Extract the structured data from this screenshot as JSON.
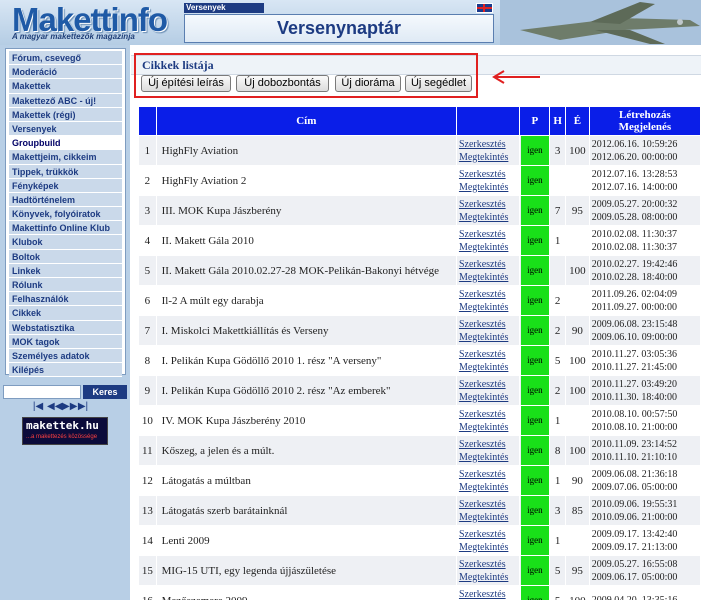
{
  "header": {
    "logo_title": "Makettinfo",
    "logo_subtitle": "A magyar makettezők magazinja",
    "section_tag": "Versenyek",
    "page_heading": "Versenynaptár"
  },
  "sidebar": {
    "items": [
      {
        "label": "Fórum, csevegő"
      },
      {
        "label": "Moderáció"
      },
      {
        "label": "Makettek"
      },
      {
        "label": "Makettező ABC - új!"
      },
      {
        "label": "Makettek (régi)"
      },
      {
        "label": "Versenyek"
      },
      {
        "label": "Groupbuild",
        "active": true
      },
      {
        "label": "Makettjeim, cikkeim"
      },
      {
        "label": "Tippek, trükkök"
      },
      {
        "label": "Fényképek"
      },
      {
        "label": "Hadtörténelem"
      },
      {
        "label": "Könyvek, folyóiratok"
      },
      {
        "label": "Makettinfo Online Klub"
      },
      {
        "label": "Klubok"
      },
      {
        "label": "Boltok"
      },
      {
        "label": "Linkek"
      },
      {
        "label": "Rólunk"
      },
      {
        "label": "Felhasználók"
      },
      {
        "label": "Cikkek"
      },
      {
        "label": "Webstatisztika"
      },
      {
        "label": "MOK tagok"
      },
      {
        "label": "Személyes adatok"
      },
      {
        "label": "Kilépés"
      }
    ],
    "search": {
      "placeholder": "",
      "button_label": "Keres"
    },
    "pager": {
      "first": "|◀",
      "prev": "◀◀",
      "next": "▶▶",
      "last": "▶|"
    },
    "banner": {
      "title": "makettek.hu",
      "subtitle": "...a makettezés közössége"
    }
  },
  "main": {
    "list_title": "Cikkek listája",
    "buttons": {
      "new_build": "Új építési leírás",
      "new_box": "Új dobozbontás",
      "new_diorama": "Új dioráma",
      "new_help": "Új segédlet"
    },
    "table": {
      "headers": {
        "num": "",
        "title": "Cím",
        "links": "",
        "p": "P",
        "h": "H",
        "e": "É",
        "dates": "Létrehozás Megjelenés"
      },
      "edit_label": "Szerkesztés",
      "view_label": "Megtekintés",
      "rows": [
        {
          "num": "1",
          "title": "HighFly Aviation",
          "p": "igen",
          "h": "3",
          "e": "100",
          "created": "2012.06.16. 10:59:26",
          "published": "2012.06.20. 00:00:00"
        },
        {
          "num": "2",
          "title": "HighFly Aviation 2",
          "p": "igen",
          "h": "",
          "e": "",
          "created": "2012.07.16. 13:28:53",
          "published": "2012.07.16. 14:00:00"
        },
        {
          "num": "3",
          "title": "III. MOK Kupa Jászberény",
          "p": "igen",
          "h": "7",
          "e": "95",
          "created": "2009.05.27. 20:00:32",
          "published": "2009.05.28. 08:00:00"
        },
        {
          "num": "4",
          "title": "II. Makett Gála 2010",
          "p": "igen",
          "h": "1",
          "e": "",
          "created": "2010.02.08. 11:30:37",
          "published": "2010.02.08. 11:30:37"
        },
        {
          "num": "5",
          "title": "II. Makett Gála 2010.02.27-28 MOK-Pelikán-Bakonyi hétvége",
          "p": "igen",
          "h": "",
          "e": "100",
          "created": "2010.02.27. 19:42:46",
          "published": "2010.02.28. 18:40:00"
        },
        {
          "num": "6",
          "title": "Il-2 A múlt egy darabja",
          "p": "igen",
          "h": "2",
          "e": "",
          "created": "2011.09.26. 02:04:09",
          "published": "2011.09.27. 00:00:00"
        },
        {
          "num": "7",
          "title": "I. Miskolci Makettkiállítás és Verseny",
          "p": "igen",
          "h": "2",
          "e": "90",
          "created": "2009.06.08. 23:15:48",
          "published": "2009.06.10. 09:00:00"
        },
        {
          "num": "8",
          "title": "I. Pelikán Kupa Gödöllő 2010 1. rész \"A verseny\"",
          "p": "igen",
          "h": "5",
          "e": "100",
          "created": "2010.11.27. 03:05:36",
          "published": "2010.11.27. 21:45:00"
        },
        {
          "num": "9",
          "title": "I. Pelikán Kupa Gödöllő 2010 2. rész \"Az emberek\"",
          "p": "igen",
          "h": "2",
          "e": "100",
          "created": "2010.11.27. 03:49:20",
          "published": "2010.11.30. 18:40:00"
        },
        {
          "num": "10",
          "title": "IV. MOK Kupa Jászberény 2010",
          "p": "igen",
          "h": "1",
          "e": "",
          "created": "2010.08.10. 00:57:50",
          "published": "2010.08.10. 21:00:00"
        },
        {
          "num": "11",
          "title": "Kőszeg, a jelen és a múlt.",
          "p": "igen",
          "h": "8",
          "e": "100",
          "created": "2010.11.09. 23:14:52",
          "published": "2010.11.10. 21:10:10"
        },
        {
          "num": "12",
          "title": "Látogatás a múltban",
          "p": "igen",
          "h": "1",
          "e": "90",
          "created": "2009.06.08. 21:36:18",
          "published": "2009.07.06. 05:00:00"
        },
        {
          "num": "13",
          "title": "Látogatás szerb barátainknál",
          "p": "igen",
          "h": "3",
          "e": "85",
          "created": "2010.09.06. 19:55:31",
          "published": "2010.09.06. 21:00:00"
        },
        {
          "num": "14",
          "title": "Lenti 2009",
          "p": "igen",
          "h": "1",
          "e": "",
          "created": "2009.09.17. 13:42:40",
          "published": "2009.09.17. 21:13:00"
        },
        {
          "num": "15",
          "title": "MIG-15 UTI, egy legenda újjászületése",
          "p": "igen",
          "h": "5",
          "e": "95",
          "created": "2009.05.27. 16:55:08",
          "published": "2009.06.17. 05:00:00"
        },
        {
          "num": "16",
          "title": "Mezőszemere 2009",
          "p": "igen",
          "h": "5",
          "e": "100",
          "created": "2009.04.20. 13:35:16",
          "published": ""
        }
      ]
    }
  }
}
